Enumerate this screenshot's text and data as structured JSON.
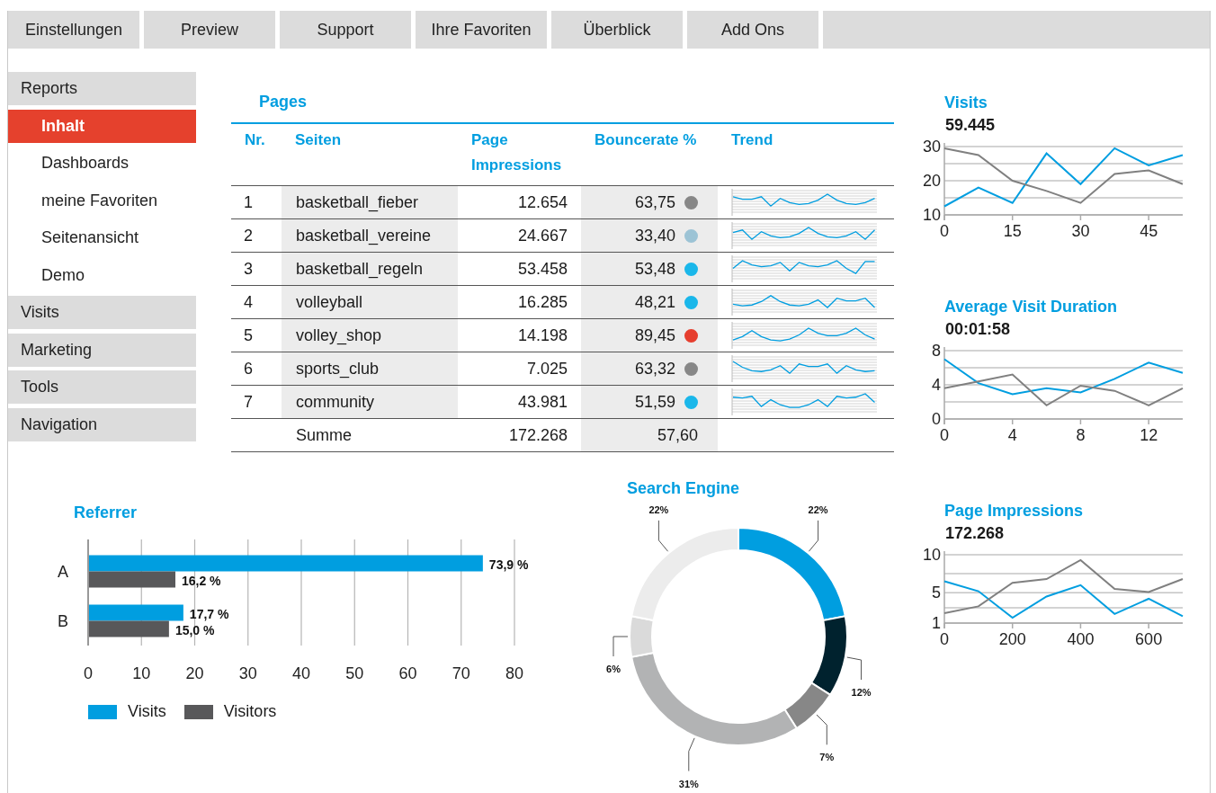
{
  "tabs": [
    {
      "label": "Einstellungen",
      "selected": false
    },
    {
      "label": "Preview",
      "selected": false
    },
    {
      "label": "Support",
      "selected": false
    },
    {
      "label": "Ihre Favoriten",
      "selected": false
    },
    {
      "label": "Überblick",
      "selected": false
    },
    {
      "label": "Add Ons",
      "selected": false
    }
  ],
  "sidebar": {
    "items": [
      {
        "label": "Reports",
        "selected": false,
        "children": [
          {
            "label": "Inhalt",
            "selected": true
          },
          {
            "label": "Dashboards",
            "selected": false
          },
          {
            "label": "meine Favoriten",
            "selected": false
          },
          {
            "label": "Seitenansicht",
            "selected": false
          },
          {
            "label": "Demo",
            "selected": false
          }
        ]
      },
      {
        "label": "Visits",
        "selected": false
      },
      {
        "label": "Marketing",
        "selected": false
      },
      {
        "label": "Tools",
        "selected": false
      },
      {
        "label": "Navigation",
        "selected": false
      }
    ]
  },
  "pages": {
    "title": "Pages",
    "columns": [
      "Nr.",
      "Seiten",
      "Page Impressions",
      "Bouncerate %",
      "Trend"
    ],
    "rows": [
      {
        "nr": "1",
        "page": "basketball_fieber",
        "impressions": "12.654",
        "bouncerate": "63,75",
        "color": "#878787"
      },
      {
        "nr": "2",
        "page": "basketball_vereine",
        "impressions": "24.667",
        "bouncerate": "33,40",
        "color": "#9cc3d5"
      },
      {
        "nr": "3",
        "page": "basketball_regeln",
        "impressions": "53.458",
        "bouncerate": "53,48",
        "color": "#1ab7ea"
      },
      {
        "nr": "4",
        "page": "volleyball",
        "impressions": "16.285",
        "bouncerate": "48,21",
        "color": "#1ab7ea"
      },
      {
        "nr": "5",
        "page": "volley_shop",
        "impressions": "14.198",
        "bouncerate": "89,45",
        "color": "#e63e2e"
      },
      {
        "nr": "6",
        "page": "sports_club",
        "impressions": "7.025",
        "bouncerate": "63,32",
        "color": "#878787"
      },
      {
        "nr": "7",
        "page": "community",
        "impressions": "43.981",
        "bouncerate": "51,59",
        "color": "#1ab7ea"
      }
    ],
    "total": {
      "label": "Summe",
      "impressions": "172.268",
      "bouncerate": "57,60"
    }
  },
  "referrer": {
    "title": "Referrer",
    "chart_data": {
      "type": "bar",
      "orientation": "horizontal",
      "categories": [
        "A",
        "B"
      ],
      "series": [
        {
          "name": "Visits",
          "color": "#009ee0",
          "values": [
            73.9,
            17.7
          ]
        },
        {
          "name": "Visitors",
          "color": "#58585a",
          "values": [
            16.2,
            15.0
          ]
        }
      ],
      "xlim": [
        0,
        80
      ],
      "xticks": [
        0,
        10,
        20,
        30,
        40,
        50,
        60,
        70,
        80
      ],
      "grid": true,
      "value_labels": [
        [
          "73,9 %",
          "17,7 %"
        ],
        [
          "16,2 %",
          "15,0 %"
        ]
      ]
    }
  },
  "search_engine": {
    "title": "Search Engine",
    "chart_data": {
      "type": "donut",
      "values": [
        22,
        12,
        7,
        31,
        6,
        22
      ],
      "colors": [
        "#009ee0",
        "#00222e",
        "#878787",
        "#b2b3b4",
        "#dadada",
        "#ececec"
      ],
      "value_labels": [
        "22%",
        "12%",
        "7%",
        "31%",
        "6%",
        "22%"
      ]
    }
  },
  "kpis": [
    {
      "title": "Visits",
      "value": "59.445",
      "chart_data": {
        "type": "line",
        "x": [
          0,
          7.5,
          15,
          22.5,
          30,
          37.5,
          45,
          52.5
        ],
        "xlim": [
          0,
          52.5
        ],
        "ylim": [
          10,
          30
        ],
        "grid": true,
        "xticks": [
          0,
          15,
          30,
          45
        ],
        "yticks": [
          10,
          20,
          30
        ],
        "series": [
          {
            "color": "#009ee0",
            "values": [
              12.5,
              18,
              13.5,
              28,
              19,
              29.5,
              24.5,
              27.5
            ]
          },
          {
            "color": "#808080",
            "values": [
              29.5,
              27.5,
              20,
              17,
              13.5,
              22,
              23,
              19
            ]
          }
        ]
      }
    },
    {
      "title": "Average Visit Duration",
      "value": "00:01:58",
      "chart_data": {
        "type": "line",
        "x": [
          0,
          2,
          4,
          6,
          8,
          10,
          12,
          14
        ],
        "xlim": [
          0,
          14
        ],
        "ylim": [
          0,
          8
        ],
        "grid": true,
        "xticks": [
          0,
          4,
          8,
          12
        ],
        "yticks": [
          0,
          4,
          8
        ],
        "series": [
          {
            "color": "#009ee0",
            "values": [
              7,
              4.2,
              2.9,
              3.6,
              3.1,
              4.7,
              6.6,
              5.4
            ]
          },
          {
            "color": "#808080",
            "values": [
              3.6,
              4.4,
              5.2,
              1.6,
              3.9,
              3.3,
              1.6,
              3.6
            ]
          }
        ]
      }
    },
    {
      "title": "Page Impressions",
      "value": "172.268",
      "chart_data": {
        "type": "line",
        "x": [
          0,
          100,
          200,
          300,
          400,
          500,
          600,
          700
        ],
        "xlim": [
          0,
          700
        ],
        "ylim": [
          1,
          10
        ],
        "grid": true,
        "xticks": [
          0,
          200,
          400,
          600
        ],
        "yticks": [
          1,
          5,
          10
        ],
        "series": [
          {
            "color": "#009ee0",
            "values": [
              6.5,
              5.2,
              1.7,
              4.5,
              6,
              2.2,
              4.2,
              1.9
            ]
          },
          {
            "color": "#808080",
            "values": [
              2.3,
              3.2,
              6.3,
              6.8,
              9.3,
              5.5,
              5.1,
              6.8
            ]
          }
        ]
      }
    }
  ]
}
